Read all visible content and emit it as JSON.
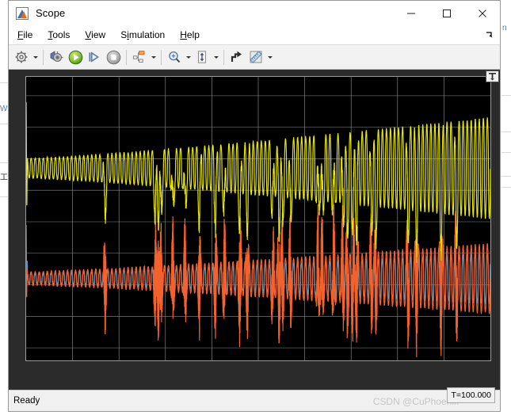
{
  "window": {
    "title": "Scope",
    "icon": "matlab-scope-icon",
    "controls": [
      {
        "name": "minimize-button",
        "glyph": "minimize-icon"
      },
      {
        "name": "maximize-button",
        "glyph": "maximize-icon"
      },
      {
        "name": "close-button",
        "glyph": "close-icon"
      }
    ]
  },
  "menu": {
    "items": [
      {
        "label": "File",
        "mnemonic": "F"
      },
      {
        "label": "Tools",
        "mnemonic": "T"
      },
      {
        "label": "View",
        "mnemonic": "V"
      },
      {
        "label": "Simulation",
        "mnemonic": "i"
      },
      {
        "label": "Help",
        "mnemonic": "H"
      }
    ],
    "overflow_icon": "menu-overflow-arrow-icon"
  },
  "toolbar": {
    "buttons": [
      {
        "name": "configuration-properties-button",
        "icon": "gear-icon",
        "has_dropdown": true
      },
      {
        "name": "run-back-to-start-button",
        "icon": "rewind-run-icon",
        "has_dropdown": false
      },
      {
        "name": "run-button",
        "icon": "play-icon",
        "has_dropdown": false
      },
      {
        "name": "step-forward-button",
        "icon": "step-forward-icon",
        "has_dropdown": false
      },
      {
        "name": "stop-button",
        "icon": "stop-icon",
        "has_dropdown": false
      },
      {
        "name": "signal-selection-button",
        "icon": "signal-hierarchy-icon",
        "has_dropdown": true
      },
      {
        "name": "zoom-button",
        "icon": "zoom-in-icon",
        "has_dropdown": true
      },
      {
        "name": "autoscale-button",
        "icon": "autoscale-arrows-icon",
        "has_dropdown": true
      },
      {
        "name": "scale-axes-limits-button",
        "icon": "scale-axes-icon",
        "has_dropdown": false
      },
      {
        "name": "cursor-measurements-button",
        "icon": "ruler-icon",
        "has_dropdown": true
      }
    ]
  },
  "plot": {
    "pin_icon": "pin-icon",
    "background": "#000000",
    "grid_color": "#8c8c8c",
    "tick_color": "#c9c9c9"
  },
  "status": {
    "text": "Ready",
    "sim_time": "T=100.000",
    "watermark": "CSDN @CuPhoenix"
  },
  "chart_data": {
    "type": "line",
    "title": "",
    "xlabel": "",
    "ylabel": "",
    "xlim": [
      0,
      100
    ],
    "ylim": [
      -34,
      56
    ],
    "xticks": [
      0,
      10,
      20,
      30,
      40,
      50,
      60,
      70,
      80,
      90,
      100
    ],
    "yticks": [
      50,
      40,
      30,
      20,
      10,
      0,
      -10,
      -20,
      -30
    ],
    "grid": true,
    "legend": "none",
    "series": [
      {
        "name": "signal-yellow",
        "color": "#e8e800",
        "description": "High-frequency oscillation centered near +27, envelope growing from +-3 to +-16, with sharp downward spikes to about +12 recurring after t=28",
        "center": 27,
        "envelope_start": 3,
        "envelope_end": 16,
        "max": 48,
        "min": 11
      },
      {
        "name": "signal-orange",
        "color": "#f2622a",
        "description": "High-frequency oscillation centered near -8, envelope growing from +-2 to +-11, with deep downward spikes reaching about -25 and upward excursions to +14",
        "center": -8,
        "envelope_start": 2,
        "envelope_end": 11,
        "max": 14,
        "min": -25
      },
      {
        "name": "signal-blue",
        "color": "#4e9ad6",
        "description": "Lower-amplitude trace overlapping the orange signal, dipping to about -18 at spike events and rising toward +2",
        "center": -8,
        "max": 3,
        "min": -19
      }
    ]
  }
}
